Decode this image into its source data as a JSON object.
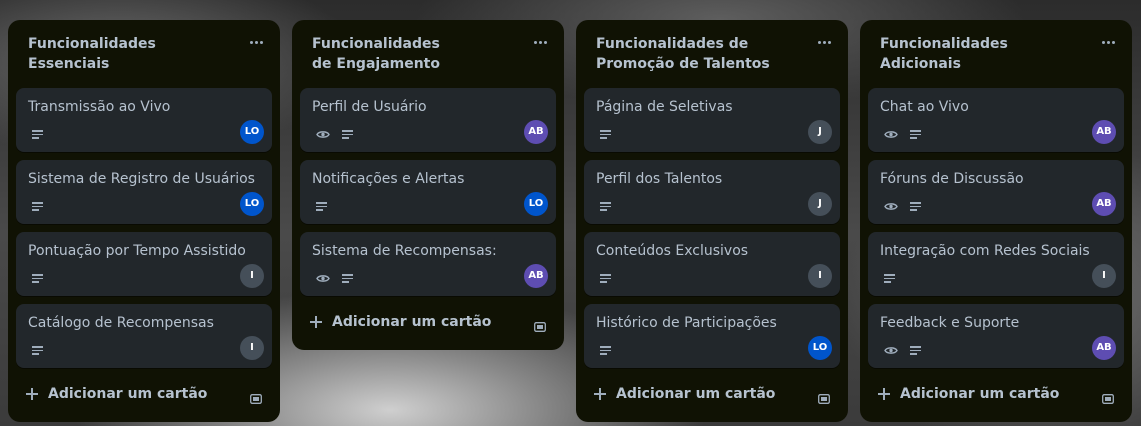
{
  "colors": {
    "list_bg": "#101204",
    "card_bg": "#22272b",
    "text": "#b6c2cf",
    "icon": "#9fadbc"
  },
  "members": {
    "LO": {
      "initials": "LO",
      "color": "#0055cc"
    },
    "AB": {
      "initials": "AB",
      "color": "#5e4db2"
    },
    "I": {
      "initials": "I",
      "color": "#454f59"
    },
    "J": {
      "initials": "J",
      "color": "#454f59"
    }
  },
  "add_card_label": "Adicionar um cartão",
  "lists": [
    {
      "title": "Funcionalidades Essenciais",
      "cards": [
        {
          "title": "Transmissão ao Vivo",
          "watch": false,
          "member": "LO"
        },
        {
          "title": "Sistema de Registro de Usuários",
          "watch": false,
          "member": "LO"
        },
        {
          "title": "Pontuação por Tempo Assistido",
          "watch": false,
          "member": "I"
        },
        {
          "title": "Catálogo de Recompensas",
          "watch": false,
          "member": "I"
        }
      ]
    },
    {
      "title": "Funcionalidades de Engajamento",
      "cards": [
        {
          "title": "Perfil de Usuário",
          "watch": true,
          "member": "AB"
        },
        {
          "title": "Notificações e Alertas",
          "watch": false,
          "member": "LO"
        },
        {
          "title": "Sistema de Recompensas:",
          "watch": true,
          "member": "AB"
        }
      ]
    },
    {
      "title": "Funcionalidades de Promoção de Talentos",
      "cards": [
        {
          "title": "Página de Seletivas",
          "watch": false,
          "member": "J"
        },
        {
          "title": "Perfil dos Talentos",
          "watch": false,
          "member": "J"
        },
        {
          "title": "Conteúdos Exclusivos",
          "watch": false,
          "member": "I"
        },
        {
          "title": "Histórico de Participações",
          "watch": false,
          "member": "LO"
        }
      ]
    },
    {
      "title": "Funcionalidades Adicionais",
      "cards": [
        {
          "title": "Chat ao Vivo",
          "watch": true,
          "member": "AB"
        },
        {
          "title": "Fóruns de Discussão",
          "watch": true,
          "member": "AB"
        },
        {
          "title": "Integração com Redes Sociais",
          "watch": false,
          "member": "I"
        },
        {
          "title": "Feedback e Suporte",
          "watch": true,
          "member": "AB"
        }
      ]
    }
  ]
}
